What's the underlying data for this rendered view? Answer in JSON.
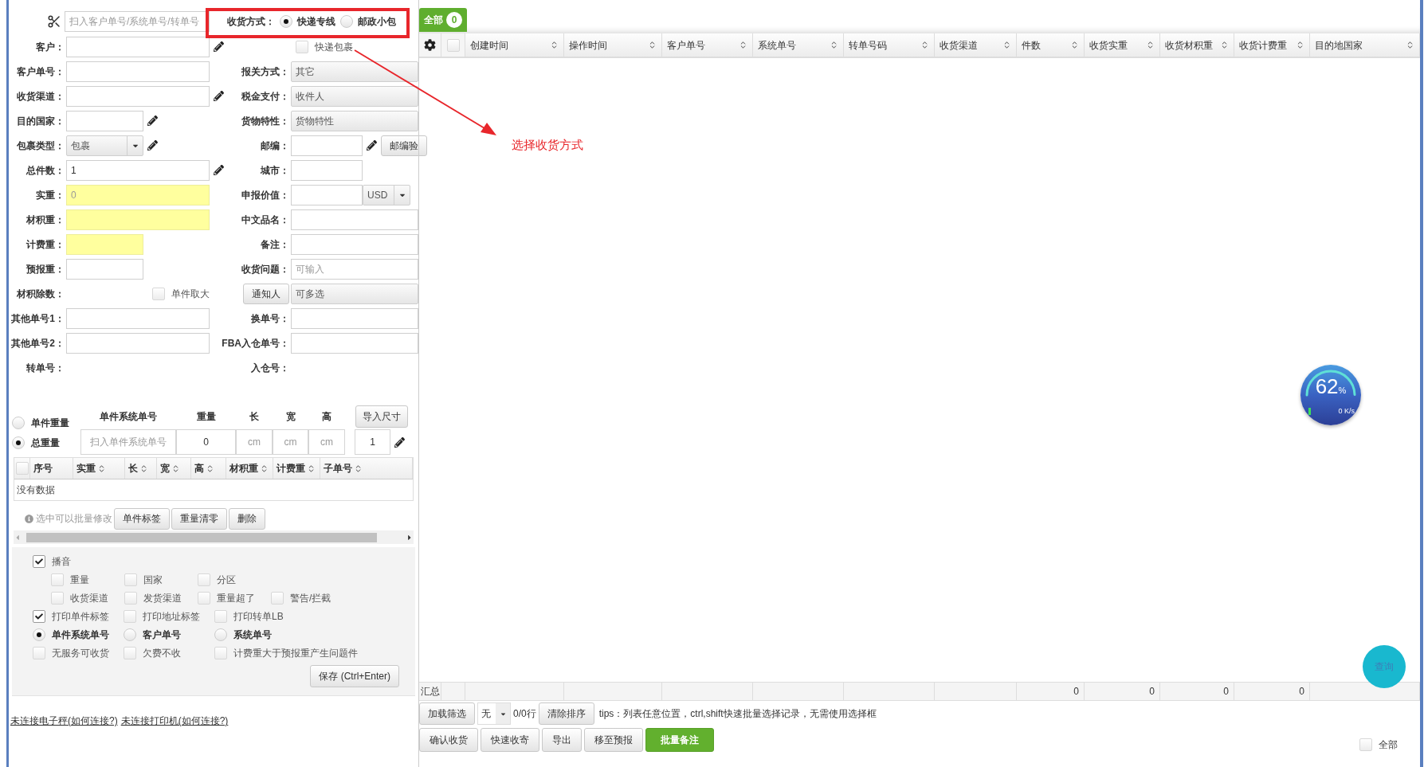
{
  "annotation": {
    "text": "选择收货方式"
  },
  "form": {
    "scan": {
      "placeholder": "扫入客户单号/系统单号/转单号"
    },
    "receive_method": {
      "label": "收货方式：",
      "options": [
        {
          "label": "快递专线",
          "selected": true
        },
        {
          "label": "邮政小包",
          "selected": false
        }
      ]
    },
    "rows": [
      {
        "left": {
          "label": "客户：",
          "kind": "input",
          "editable": true
        },
        "right": {
          "kind": "checkbox",
          "option": "快递包裹",
          "checked": false
        }
      },
      {
        "left": {
          "label": "客户单号：",
          "kind": "input"
        },
        "right": {
          "label": "报关方式：",
          "kind": "select",
          "value": "其它"
        }
      },
      {
        "left": {
          "label": "收货渠道：",
          "kind": "input",
          "editable": true
        },
        "right": {
          "label": "税金支付：",
          "kind": "select",
          "value": "收件人"
        }
      },
      {
        "left": {
          "label": "目的国家：",
          "kind": "input",
          "editable": true
        },
        "right": {
          "label": "货物特性：",
          "kind": "select",
          "value": "货物特性"
        }
      },
      {
        "left": {
          "label": "包裹类型：",
          "kind": "dropdown",
          "value": "包裹",
          "editable": true
        },
        "right": {
          "label": "邮编：",
          "kind": "input",
          "editable": true,
          "button": "邮编验"
        }
      },
      {
        "left": {
          "label": "总件数：",
          "kind": "input",
          "value": "1",
          "editable": true
        },
        "right": {
          "label": "城市：",
          "kind": "input"
        }
      },
      {
        "left": {
          "label": "实重：",
          "kind": "input",
          "placeholder": "0",
          "highlighted": true
        },
        "right": {
          "label": "申报价值：",
          "kind": "input",
          "currency": "USD"
        }
      },
      {
        "left": {
          "label": "材积重：",
          "kind": "input",
          "highlighted": true
        },
        "right": {
          "label": "中文品名：",
          "kind": "input"
        }
      },
      {
        "left": {
          "label": "计费重：",
          "kind": "input",
          "highlighted": true
        },
        "right": {
          "label": "备注：",
          "kind": "input"
        }
      },
      {
        "left": {
          "label": "预报重：",
          "kind": "input"
        },
        "right": {
          "label": "收货问题：",
          "kind": "input",
          "placeholder": "可输入"
        }
      },
      {
        "left": {
          "label": "材积除数：",
          "kind": "checkbox",
          "option": "单件取大",
          "checked": false
        },
        "right": {
          "kind": "button_select",
          "label_button": "通知人",
          "value": "可多选"
        }
      },
      {
        "left": {
          "label": "其他单号1：",
          "kind": "input"
        },
        "right": {
          "label": "换单号：",
          "kind": "input"
        }
      },
      {
        "left": {
          "label": "其他单号2：",
          "kind": "input"
        },
        "right": {
          "label": "FBA入仓单号：",
          "kind": "input"
        }
      },
      {
        "left": {
          "label": "转单号：",
          "kind": "text"
        },
        "right": {
          "label": "入仓号：",
          "kind": "text"
        }
      }
    ]
  },
  "pieces": {
    "weight_modes": [
      {
        "label": "单件重量",
        "selected": false
      },
      {
        "label": "总重量",
        "selected": true
      }
    ],
    "headers": [
      "单件系统单号",
      "重量",
      "长",
      "宽",
      "高"
    ],
    "import_button": "导入尺寸",
    "inputs": [
      {
        "placeholder": "扫入单件系统单号"
      },
      {
        "value": "0"
      },
      {
        "placeholder": "cm"
      },
      {
        "placeholder": "cm"
      },
      {
        "placeholder": "cm"
      }
    ],
    "count": "1",
    "table": {
      "all_checked": false,
      "columns": [
        {
          "label": "序号",
          "sortable": false
        },
        {
          "label": "实重",
          "sortable": true
        },
        {
          "label": "长",
          "sortable": true
        },
        {
          "label": "宽",
          "sortable": true
        },
        {
          "label": "高",
          "sortable": true
        },
        {
          "label": "材积重",
          "sortable": true
        },
        {
          "label": "计费重",
          "sortable": true
        },
        {
          "label": "子单号",
          "sortable": true
        }
      ],
      "empty": "没有数据"
    },
    "hint": "选中可以批量修改",
    "buttons": [
      "单件标签",
      "重量清零",
      "删除"
    ]
  },
  "options": [
    {
      "items": [
        {
          "kind": "checkbox",
          "label": "播音",
          "checked": true
        }
      ],
      "children": [
        {
          "items": [
            {
              "kind": "checkbox",
              "label": "重量",
              "checked": false
            },
            {
              "kind": "checkbox",
              "label": "国家",
              "checked": false
            },
            {
              "kind": "checkbox",
              "label": "分区",
              "checked": false
            }
          ]
        },
        {
          "items": [
            {
              "kind": "checkbox",
              "label": "收货渠道",
              "checked": false
            },
            {
              "kind": "checkbox",
              "label": "发货渠道",
              "checked": false
            },
            {
              "kind": "checkbox",
              "label": "重量超了",
              "checked": false
            },
            {
              "kind": "checkbox",
              "label": "警告/拦截",
              "checked": false
            }
          ]
        }
      ]
    },
    {
      "items": [
        {
          "kind": "checkbox",
          "label": "打印单件标签",
          "checked": true
        },
        {
          "kind": "checkbox",
          "label": "打印地址标签",
          "checked": false
        },
        {
          "kind": "checkbox",
          "label": "打印转单LB",
          "checked": false
        }
      ]
    },
    {
      "items": [
        {
          "kind": "radio",
          "label": "单件系统单号",
          "selected": true
        },
        {
          "kind": "radio",
          "label": "客户单号",
          "selected": false
        },
        {
          "kind": "radio",
          "label": "系统单号",
          "selected": false
        }
      ]
    },
    {
      "items": [
        {
          "kind": "checkbox",
          "label": "无服务可收货",
          "checked": false
        },
        {
          "kind": "checkbox",
          "label": "欠费不收",
          "checked": false
        },
        {
          "kind": "checkbox",
          "label": "计费重大于预报重产生问题件",
          "checked": false
        }
      ]
    }
  ],
  "save_button": "保存 (Ctrl+Enter)",
  "links": [
    "未连接电子秤(如何连接?)",
    "未连接打印机(如何连接?)"
  ],
  "tabs": [
    {
      "label": "全部",
      "count": "0",
      "selected": true
    }
  ],
  "table": {
    "all_checked": false,
    "columns": [
      {
        "label": "创建时间"
      },
      {
        "label": "操作时间"
      },
      {
        "label": "客户单号"
      },
      {
        "label": "系统单号"
      },
      {
        "label": "转单号码"
      },
      {
        "label": "收货渠道"
      },
      {
        "label": "件数",
        "total": "0"
      },
      {
        "label": "收货实重",
        "total": "0"
      },
      {
        "label": "收货材积重",
        "total": "0"
      },
      {
        "label": "收货计费重",
        "total": "0"
      },
      {
        "label": "目的地国家"
      }
    ],
    "summary_label": "汇总"
  },
  "gauge": {
    "value": "62",
    "unit": "%",
    "speed": "0 K/s",
    "level": 0.62
  },
  "query_button": "查询",
  "toolbar": {
    "filter_button": "加载筛选",
    "select": "无",
    "rows": "0/0行",
    "clear_sort": "清除排序",
    "tips": "tips：列表任意位置，ctrl,shift快速批量选择记录，无需使用选择框"
  },
  "actions": [
    {
      "label": "确认收货",
      "kind": "default"
    },
    {
      "label": "快速收寄",
      "kind": "default"
    },
    {
      "label": "导出",
      "kind": "default"
    },
    {
      "label": "移至预报",
      "kind": "default"
    },
    {
      "label": "批量备注",
      "kind": "primary"
    }
  ],
  "select_all": {
    "label": "全部",
    "checked": false
  }
}
